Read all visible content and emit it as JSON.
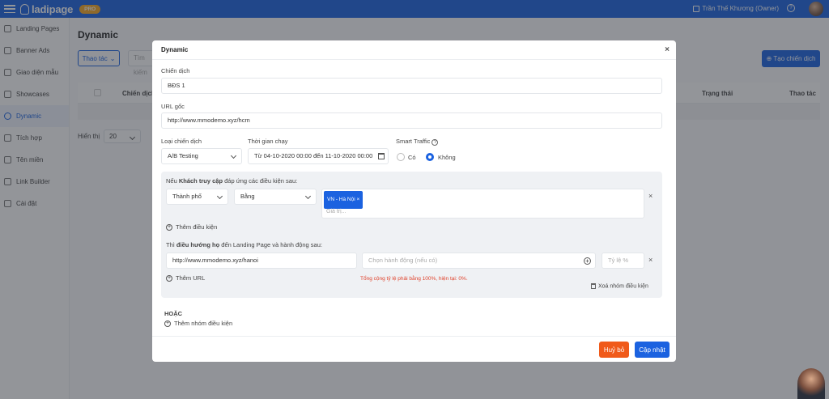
{
  "topbar": {
    "brand": "ladipage",
    "badge": "PRO",
    "user": "Trần Thế Khương (Owner)",
    "help": "?"
  },
  "sidebar": {
    "items": [
      {
        "label": "Landing Pages"
      },
      {
        "label": "Banner Ads"
      },
      {
        "label": "Giao diện mẫu"
      },
      {
        "label": "Showcases"
      },
      {
        "label": "Dynamic"
      },
      {
        "label": "Tích hợp"
      },
      {
        "label": "Tên miền"
      },
      {
        "label": "Link Builder"
      },
      {
        "label": "Cài đặt"
      }
    ],
    "active": "Dynamic"
  },
  "page": {
    "title": "Dynamic",
    "actions_label": "Thao tác",
    "search_placeholder": "Tìm kiếm",
    "create_label": "⊕ Tạo chiến dịch",
    "table_headers": {
      "campaign": "Chiến dịch",
      "status": "Trạng thái",
      "actions": "Thao tác"
    },
    "page_size_label": "Hiển thị",
    "page_size": "20"
  },
  "modal": {
    "title": "Dynamic",
    "close": "×",
    "campaign_label": "Chiến dịch",
    "campaign_value": "BĐS 1",
    "url_label": "URL gốc",
    "url_value": "http://www.mmodemo.xyz/hcm",
    "type_label": "Loại chiến dịch",
    "type_value": "A/B Testing",
    "time_label": "Thời gian chạy",
    "time_value": "Từ 04-10-2020 00:00 đến 11-10-2020 00:00",
    "smart_label": "Smart Traffic",
    "smart_options": [
      "Có",
      "Không"
    ],
    "smart_selected": "Không",
    "cond_prefix": "Nếu ",
    "cond_bold": "Khách truy cập",
    "cond_suffix": " đáp ứng các điều kiện sau:",
    "cond_field": "Thành phố",
    "cond_op": "Bằng",
    "cond_tag": "VN - Hà Nội",
    "cond_value_placeholder": "Giá trị...",
    "add_condition": "Thêm điều kiện",
    "redirect_prefix": "Thì ",
    "redirect_bold": "điều hướng họ",
    "redirect_suffix": " đến Landing Page và hành động sau:",
    "redirect_url": "http://www.mmodemo.xyz/hanoi",
    "action_placeholder": "Chọn hành động (nếu có)",
    "ratio_placeholder": "Tỷ lệ %",
    "add_url": "Thêm URL",
    "ratio_error": "Tổng cộng tỷ lệ phải bằng 100%, hiện tại: 0%.",
    "delete_group": "Xoá nhóm điều kiện",
    "or_label": "HOẶC",
    "add_group": "Thêm nhóm điều kiện",
    "cancel": "Huỷ bỏ",
    "update": "Cập nhật"
  },
  "colors": {
    "primary": "#1b62e0",
    "danger": "#f05a1a",
    "badge": "#f5a623"
  }
}
